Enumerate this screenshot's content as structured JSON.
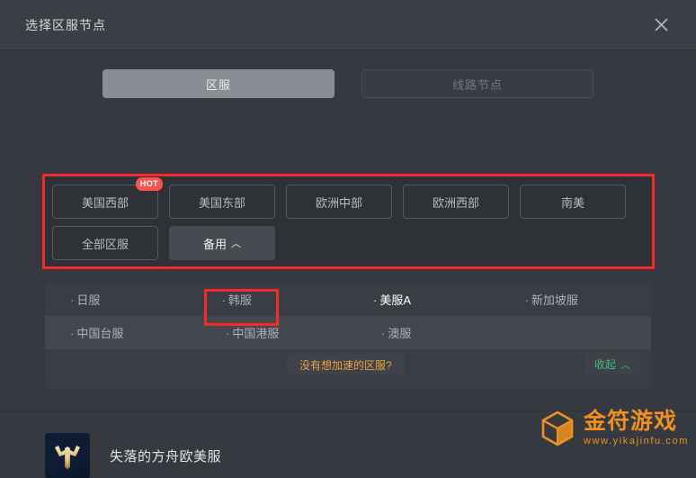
{
  "window": {
    "title": "选择区服节点",
    "close_icon": "close-icon"
  },
  "tabs": [
    {
      "label": "区服",
      "active": true
    },
    {
      "label": "线路节点",
      "active": false
    }
  ],
  "regions": {
    "row1": [
      {
        "label": "美国西部",
        "badge": "HOT",
        "selected": false
      },
      {
        "label": "美国东部",
        "badge": "",
        "selected": false
      },
      {
        "label": "欧洲中部",
        "badge": "",
        "selected": false
      },
      {
        "label": "欧洲西部",
        "badge": "",
        "selected": false
      },
      {
        "label": "南美",
        "badge": "",
        "selected": false
      }
    ],
    "row2": [
      {
        "label": "全部区服",
        "badge": "",
        "selected": false
      },
      {
        "label": "备用",
        "badge": "",
        "selected": true,
        "chevron": "︿"
      }
    ]
  },
  "servers": {
    "row1": [
      {
        "label": "日服",
        "active": false
      },
      {
        "label": "韩服",
        "active": false,
        "annotated": true
      },
      {
        "label": "美服A",
        "active": true
      },
      {
        "label": "新加坡服",
        "active": false
      }
    ],
    "row2": [
      {
        "label": "中国台服",
        "active": false
      },
      {
        "label": "中国港服",
        "active": false
      },
      {
        "label": "澳服",
        "active": false
      }
    ],
    "footer": {
      "no_server_label": "没有想加速的区服?",
      "collapse_label": "收起",
      "collapse_chevron": "︿"
    }
  },
  "game": {
    "title": "失落的方舟欧美服",
    "icon": "lost-ark-emblem-icon"
  },
  "watermark": {
    "brand": "金符游戏",
    "url": "www.yikajinfu.com",
    "cube_icon": "cube-icon"
  },
  "colors": {
    "accent_red": "#f42b2b",
    "hot_badge": "#f9524f",
    "orange_link": "#e8a33d",
    "green_link": "#3fbf7f",
    "watermark_orange": "#f7941e"
  }
}
